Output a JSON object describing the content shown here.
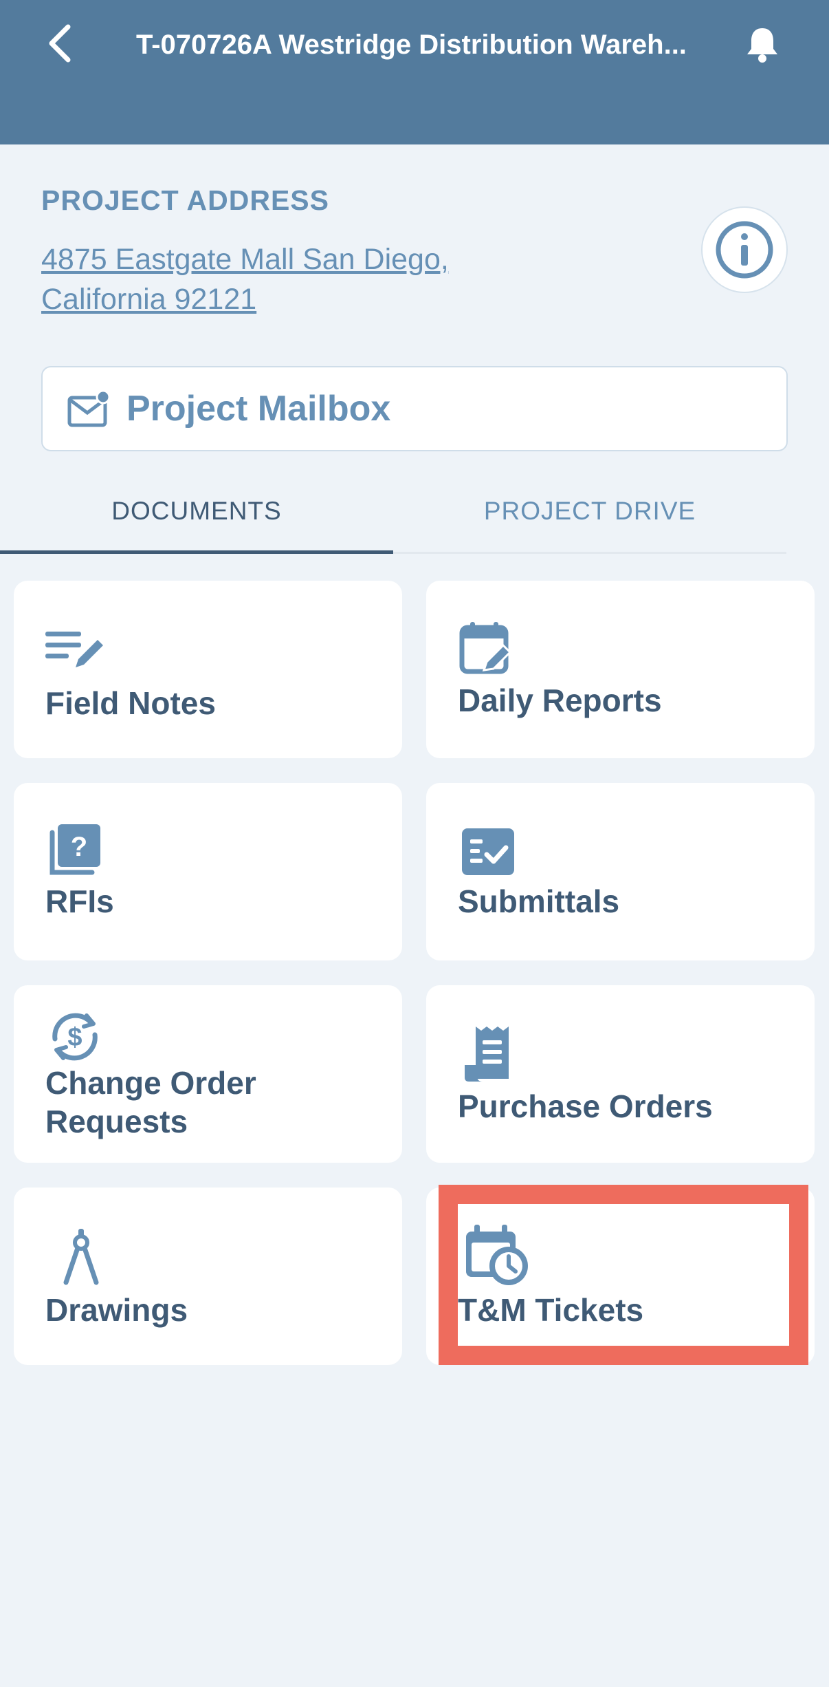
{
  "header": {
    "title": "T-070726A Westridge Distribution Wareh...",
    "bg_color": "#537b9d"
  },
  "project": {
    "address_label": "PROJECT ADDRESS",
    "address_line1": "4875 Eastgate Mall  San Diego,",
    "address_line2": "California 92121"
  },
  "mailbox": {
    "label": "Project Mailbox"
  },
  "tabs": [
    {
      "label": "DOCUMENTS",
      "active": true
    },
    {
      "label": "PROJECT DRIVE",
      "active": false
    }
  ],
  "cards": [
    {
      "label": "Field Notes",
      "icon": "notes-pencil-icon"
    },
    {
      "label": "Daily Reports",
      "icon": "calendar-edit-icon"
    },
    {
      "label": "RFIs",
      "icon": "question-stack-icon"
    },
    {
      "label": "Submittals",
      "icon": "checklist-icon"
    },
    {
      "label": "Change Order",
      "label2": "Requests",
      "icon": "dollar-cycle-icon"
    },
    {
      "label": "Purchase Orders",
      "icon": "receipt-icon"
    },
    {
      "label": "Drawings",
      "icon": "compass-icon"
    },
    {
      "label": "T&M Tickets",
      "icon": "calendar-clock-icon"
    }
  ],
  "colors": {
    "accent": "#6690b5",
    "text": "#3f5a75",
    "highlight": "#ee6c5d",
    "background": "#eef3f8"
  }
}
